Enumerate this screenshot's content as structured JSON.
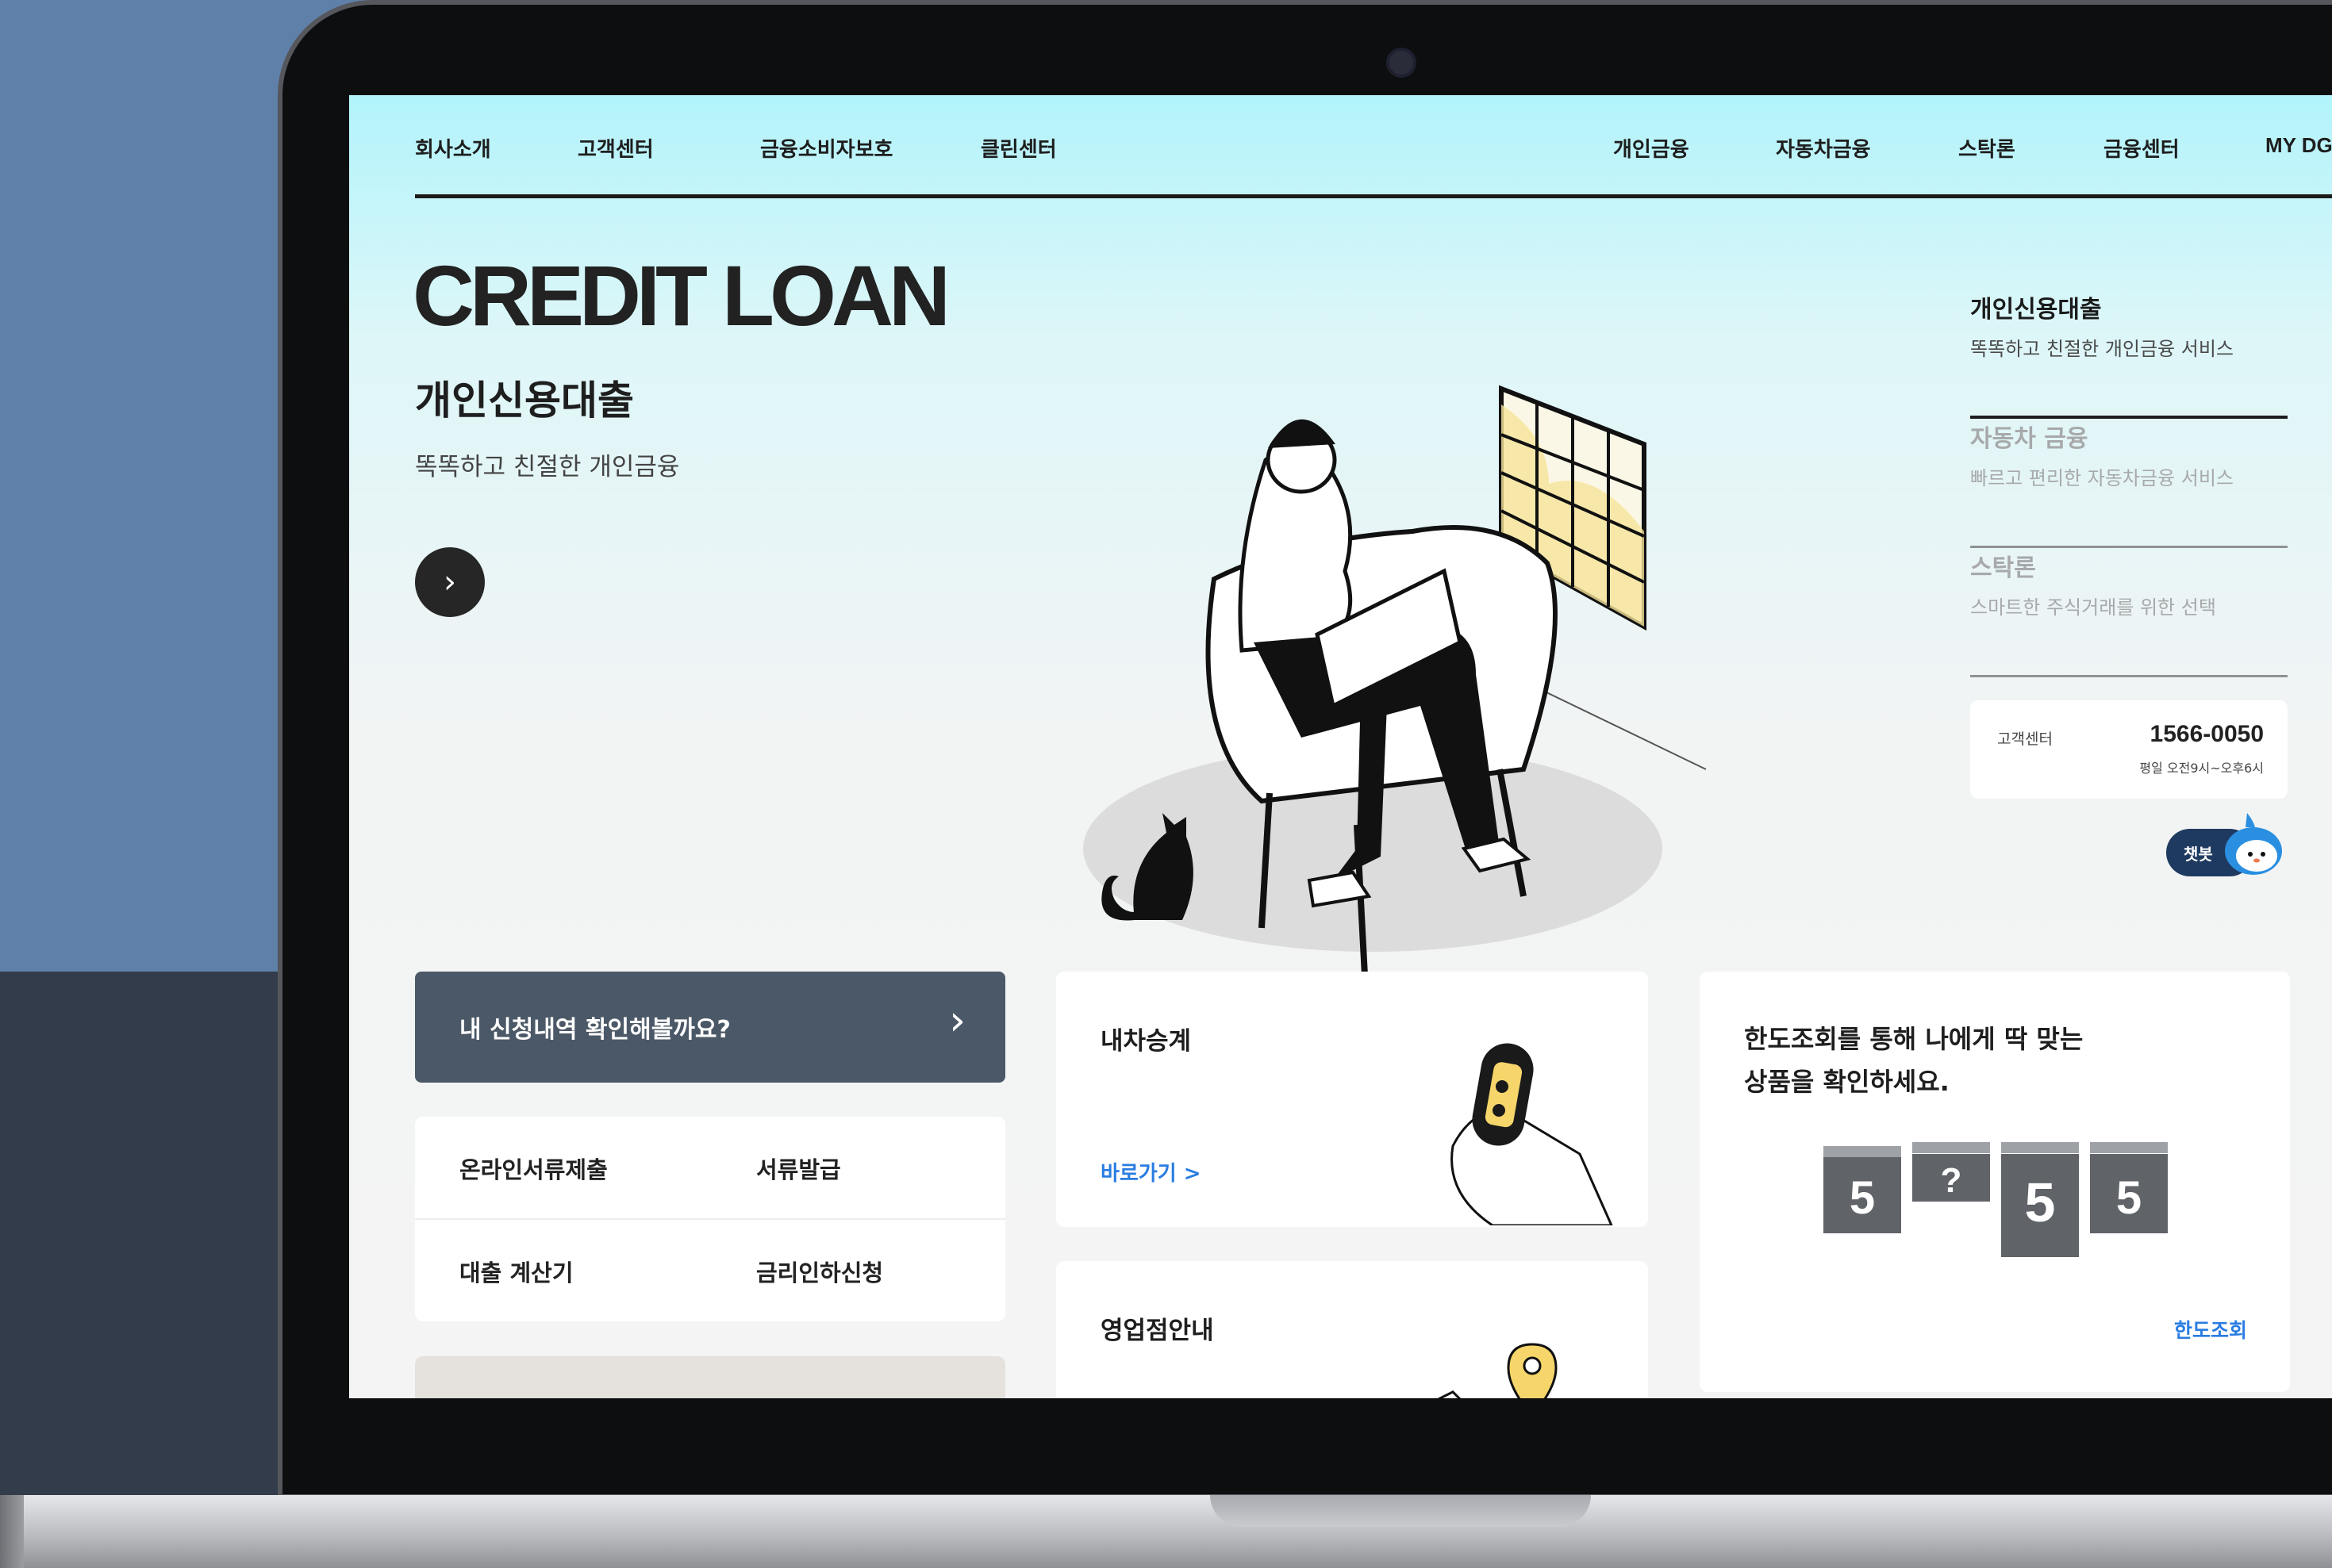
{
  "nav": {
    "left": [
      "회사소개",
      "고객센터",
      "금융소비자보호",
      "클린센터"
    ],
    "right": [
      "개인금융",
      "자동차금융",
      "스탁론",
      "금융센터",
      "MY DGB"
    ]
  },
  "hero": {
    "title": "CREDIT LOAN",
    "subtitle": "개인신용대출",
    "description": "똑똑하고 친절한 개인금융",
    "next_icon": "chevron-right-icon"
  },
  "sidebar": {
    "items": [
      {
        "title": "개인신용대출",
        "desc": "똑똑하고 친절한 개인금융 서비스",
        "active": true
      },
      {
        "title": "자동차 금융",
        "desc": "빠르고 편리한 자동차금융 서비스",
        "active": false
      },
      {
        "title": "스탁론",
        "desc": "스마트한 주식거래를 위한 선택",
        "active": false
      }
    ]
  },
  "customer_center": {
    "label": "고객센터",
    "phone": "1566-0050",
    "hours": "평일 오전9시~오후6시"
  },
  "chatbot": {
    "label": "챗봇"
  },
  "apply": {
    "label": "내 신청내역 확인해볼까요?",
    "icon": "chevron-right-icon"
  },
  "quick_links": [
    "온라인서류제출",
    "서류발급",
    "대출 계산기",
    "금리인하신청"
  ],
  "car_card": {
    "title": "내차승계",
    "link": "바로가기 >"
  },
  "branch_card": {
    "title": "영업점안내"
  },
  "limit_card": {
    "line1": "한도조회를 통해 나에게 딱 맞는",
    "line2": "상품을 확인하세요.",
    "link": "한도조회"
  },
  "colors": {
    "accent_link": "#2a7de1",
    "apply_bg": "#4b5867",
    "chatbot_bg": "#1f3a60",
    "hero_gradient_top": "#b2f4fb"
  }
}
